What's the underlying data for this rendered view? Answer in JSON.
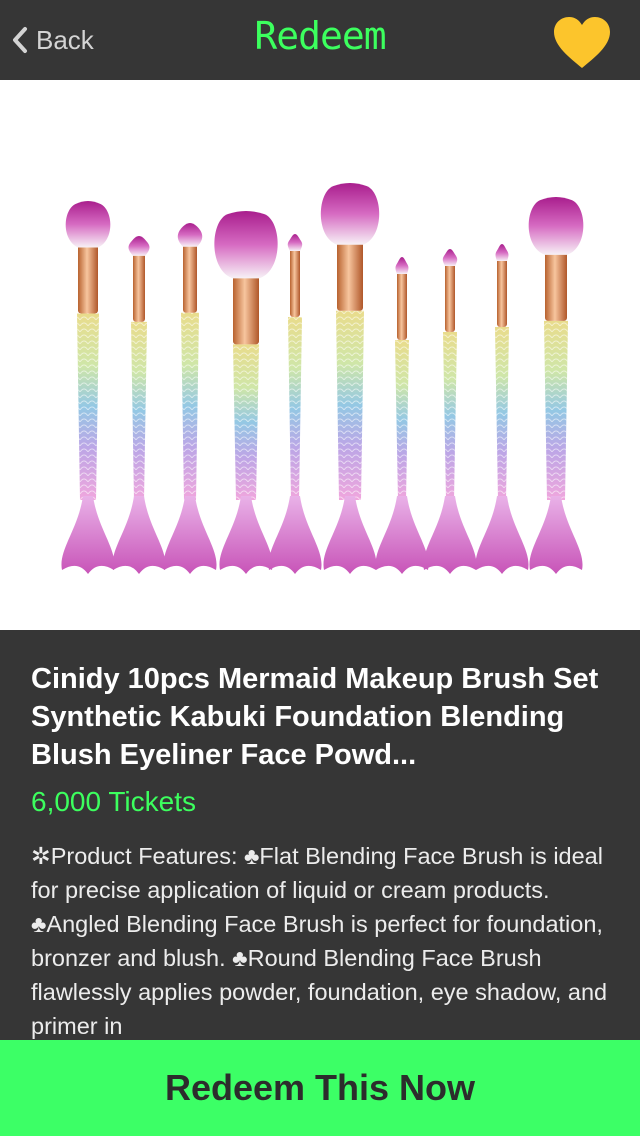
{
  "header": {
    "back_label": "Back",
    "title": "Redeem",
    "favorite_icon": "heart-icon",
    "favorite_color": "#fcc52c",
    "title_color": "#3cff5e"
  },
  "product": {
    "image_alt": "mermaid makeup brushes",
    "title": "Cinidy 10pcs Mermaid Makeup Brush Set Synthetic Kabuki Foundation Blending Blush Eyeliner Face Powd...",
    "price": "6,000 Tickets",
    "description": "✲Product Features: ♣Flat Blending Face Brush is ideal for precise application of liquid or cream products. ♣Angled Blending Face Brush is perfect for foundation, bronzer and blush. ♣Round Blending Face Brush flawlessly applies powder, foundation, eye shadow, and primer in"
  },
  "cta": {
    "label": "Redeem This Now",
    "color": "#3cff66"
  }
}
